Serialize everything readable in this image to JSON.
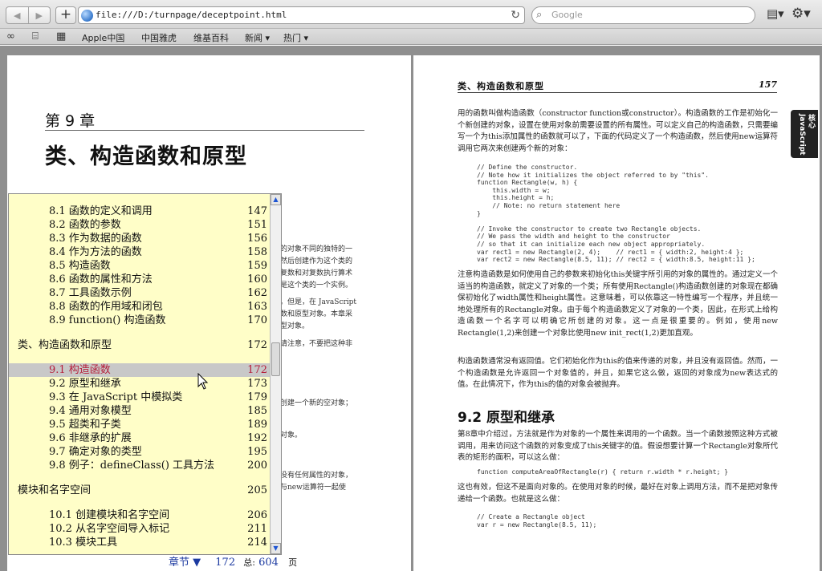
{
  "browser": {
    "url": "file:///D:/turnpage/deceptpoint.html",
    "search_placeholder": "Google",
    "back_icon": "◀",
    "forward_icon": "▶",
    "add_label": "+",
    "reload_icon": "↻",
    "bookmarks": [
      "Apple中国",
      "中国雅虎",
      "维基百科",
      "新闻 ▾",
      "热门 ▾"
    ]
  },
  "left_page": {
    "chapter_label": "第 9 章",
    "chapter_title": "类、构造函数和原型",
    "fragments": [
      "的对象不同的独特的一",
      "然后创建作为这个类的",
      "复数和对复数执行算术",
      "是这个类的一个实例。",
      "。但是，在 JavaScript",
      "数和原型对象。本章采",
      "型对象。",
      "请注意，不要把这种非",
      "创建一个新的空对象；",
      "对象。",
      "没有任何属性的对象，",
      "与new运算符一起使"
    ]
  },
  "right_page": {
    "header_title": "类、构造函数和原型",
    "header_page": "157",
    "side_tab": "核心JavaScript",
    "para1": "用的函数叫做构造函数（constructor function或constructor）。构造函数的工作是初始化一个新创建的对象，设置在使用对象前需要设置的所有属性。可以定义自己的构造函数，只需要编写一个为this添加属性的函数就可以了，下面的代码定义了一个构造函数，然后使用new运算符调用它两次来创建两个新的对象：",
    "code1": "// Define the constructor.\n// Note how it initializes the object referred to by \"this\".\nfunction Rectangle(w, h) {\n    this.width = w;\n    this.height = h;\n    // Note: no return statement here\n}\n\n// Invoke the constructor to create two Rectangle objects.\n// We pass the width and height to the constructor\n// so that it can initialize each new object appropriately.\nvar rect1 = new Rectangle(2, 4);    // rect1 = { width:2, height:4 };\nvar rect2 = new Rectangle(8.5, 11); // rect2 = { width:8.5, height:11 };",
    "para2": "注意构造函数是如何使用自己的参数来初始化this关键字所引用的对象的属性的。通过定义一个适当的构造函数，就定义了对象的一个类；所有使用Rectangle()构造函数创建的对象现在都确保初始化了width属性和height属性。这意味着，可以依靠这一特性编写一个程序，并且统一地处理所有的Rectangle对象。由于每个构造函数定义了对象的一个类，因此，在形式上给构造函数一个名字可以明确它所创建的对象。这一点是很重要的。例如，使用new Rectangle(1,2)来创建一个对象比使用new init_rect(1,2)更加直观。",
    "para3": "构造函数通常没有返回值。它们初始化作为this的值来传递的对象，并且没有返回值。然而，一个构造函数是允许返回一个对象值的，并且，如果它这么做，返回的对象成为new表达式的值。在此情况下，作为this的值的对象会被抛弃。",
    "section_title": "9.2 原型和继承",
    "para4": "第8章中介绍过，方法就是作为对象的一个属性来调用的一个函数。当一个函数按照这种方式被调用，用来访问这个函数的对象变成了this关键字的值。假设想要计算一个Rectangle对象所代表的矩形的面积，可以这么做：",
    "code2": "function computeAreaOfRectangle(r) { return r.width * r.height; }",
    "para5": "这也有效，但这不是面向对象的。在使用对象的时候，最好在对象上调用方法，而不是把对象传递给一个函数。也就是这么做：",
    "code3": "// Create a Rectangle object\nvar r = new Rectangle(8.5, 11);"
  },
  "toc": {
    "rows": [
      {
        "title": "8.1 函数的定义和调用",
        "page": "147",
        "level": 2
      },
      {
        "title": "8.2 函数的参数",
        "page": "151",
        "level": 2
      },
      {
        "title": "8.3 作为数据的函数",
        "page": "156",
        "level": 2
      },
      {
        "title": "8.4 作为方法的函数",
        "page": "158",
        "level": 2
      },
      {
        "title": "8.5 构造函数",
        "page": "159",
        "level": 2
      },
      {
        "title": "8.6 函数的属性和方法",
        "page": "160",
        "level": 2
      },
      {
        "title": "8.7 工具函数示例",
        "page": "162",
        "level": 2
      },
      {
        "title": "8.8 函数的作用域和闭包",
        "page": "163",
        "level": 2
      },
      {
        "title": "8.9 function() 构造函数",
        "page": "170",
        "level": 2
      },
      {
        "title": "类、构造函数和原型",
        "page": "172",
        "level": 1
      },
      {
        "title": "9.1 构造函数",
        "page": "172",
        "level": 2,
        "highlight": true
      },
      {
        "title": "9.2 原型和继承",
        "page": "173",
        "level": 2
      },
      {
        "title": "9.3 在 JavaScript 中模拟类",
        "page": "179",
        "level": 2
      },
      {
        "title": "9.4 通用对象模型",
        "page": "185",
        "level": 2
      },
      {
        "title": "9.5 超类和子类",
        "page": "189",
        "level": 2
      },
      {
        "title": "9.6 非继承的扩展",
        "page": "192",
        "level": 2
      },
      {
        "title": "9.7 确定对象的类型",
        "page": "195",
        "level": 2
      },
      {
        "title": "9.8 例子：defineClass() 工具方法",
        "page": "200",
        "level": 2
      },
      {
        "title": "模块和名字空间",
        "page": "205",
        "level": 1
      },
      {
        "title": "10.1 创建模块和名字空间",
        "page": "206",
        "level": 2
      },
      {
        "title": "10.2 从名字空间导入标记",
        "page": "211",
        "level": 2
      },
      {
        "title": "10.3 模块工具",
        "page": "214",
        "level": 2
      }
    ]
  },
  "pager": {
    "chapter_label": "章节 ▼",
    "current_page": "172",
    "total_label": "总:",
    "total_pages": "604",
    "unit": "页"
  }
}
